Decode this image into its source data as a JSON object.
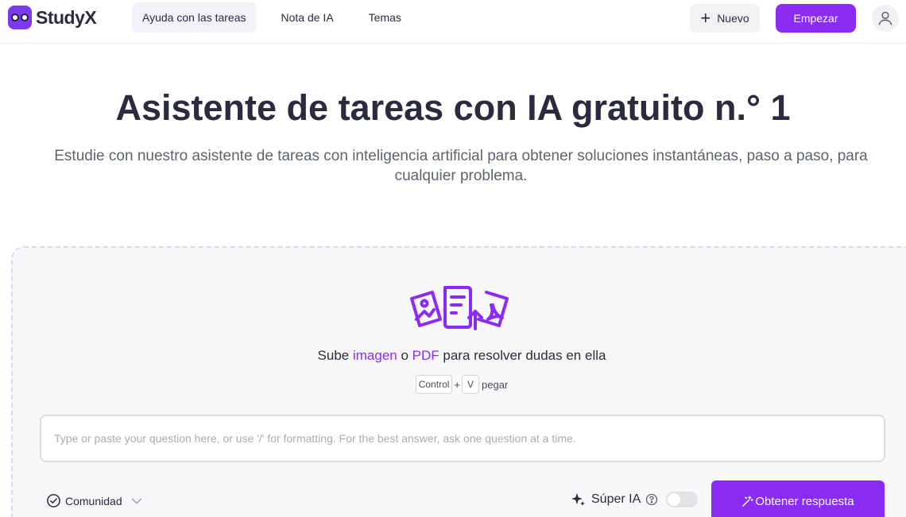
{
  "brand": {
    "name": "StudyX",
    "accent": "#8b2cf5"
  },
  "nav": {
    "items": [
      {
        "label": "Ayuda con las tareas",
        "active": true
      },
      {
        "label": "Nota de IA",
        "active": false
      },
      {
        "label": "Temas",
        "active": false
      }
    ]
  },
  "header": {
    "new_label": "Nuevo",
    "start_label": "Empezar"
  },
  "hero": {
    "title": "Asistente de tareas con IA gratuito n.° 1",
    "subtitle": "Estudie con nuestro asistente de tareas con inteligencia artificial para obtener soluciones instantáneas, paso a paso, para cualquier problema."
  },
  "upload": {
    "text_prefix": "Sube ",
    "link_image": "imagen",
    "text_or": " o ",
    "link_pdf": "PDF",
    "text_suffix": " para resolver dudas en ella",
    "key_ctrl": "Control",
    "key_plus": "+",
    "key_v": "V",
    "paste_label": "pegar"
  },
  "question": {
    "value": "",
    "placeholder": "Type or paste your question here, or use '/' for formatting. For the best answer, ask one question at a time."
  },
  "footer_controls": {
    "community_label": "Comunidad",
    "super_ai_label": "Súper IA",
    "super_ai_enabled": false,
    "answer_label": "Obtener respuesta"
  }
}
